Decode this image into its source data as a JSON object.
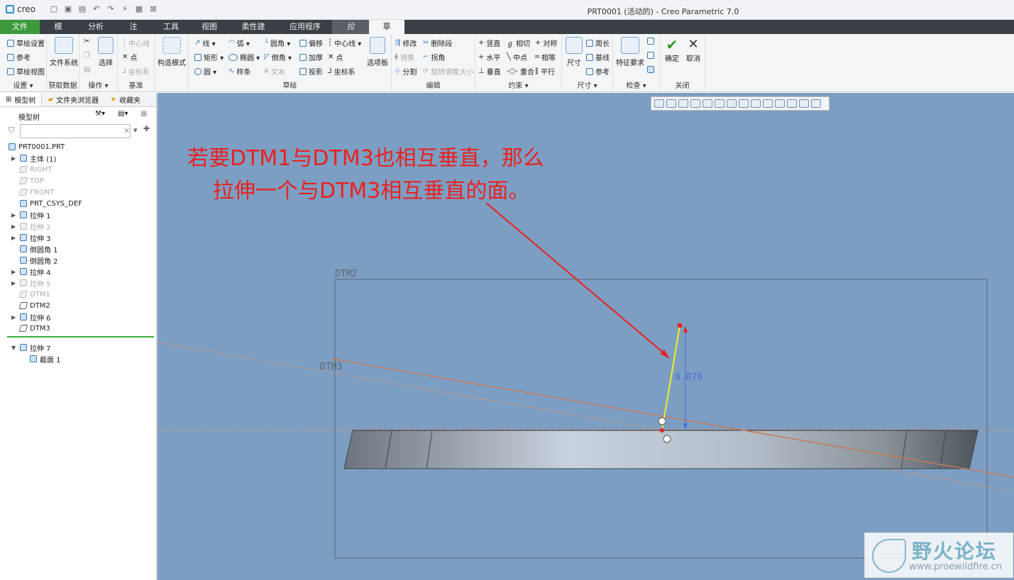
{
  "app": {
    "logo": "creo",
    "window_title": "PRT0001 (活动的) - Creo Parametric 7.0"
  },
  "tabs": [
    "文件",
    "模型",
    "分析",
    "注释",
    "工具",
    "视图",
    "柔性建模",
    "应用程序",
    "拉伸",
    "草绘"
  ],
  "ribbon": {
    "setup": {
      "items": [
        "草绘设置",
        "参考",
        "草绘视图"
      ],
      "label": "设置 ▾"
    },
    "data": {
      "big": "文件系统",
      "label": "获取数据"
    },
    "ops": {
      "big": "选择",
      "label": "操作 ▾"
    },
    "datum": {
      "items": [
        "中心线",
        "点",
        "坐标系"
      ],
      "label": "基准"
    },
    "construct": {
      "big": "构造模式"
    },
    "sketch": {
      "col1": [
        "线 ▾",
        "矩形 ▾",
        "圆 ▾"
      ],
      "col2": [
        "弧 ▾",
        "椭圆 ▾",
        "样条"
      ],
      "col3": [
        "圆角 ▾",
        "倒角 ▾",
        "文本"
      ],
      "col4": [
        "偏移",
        "加厚",
        "投影"
      ],
      "col5": [
        "中心线 ▾",
        "点",
        "坐标系"
      ],
      "big": "选项板",
      "label": "草绘"
    },
    "edit": {
      "col1": [
        "修改",
        "镜像",
        "分割"
      ],
      "col2": [
        "删除段",
        "拐角",
        "旋转调整大小"
      ],
      "label": "编辑"
    },
    "constrain": {
      "col1": [
        "竖直",
        "水平",
        "垂直"
      ],
      "col2": [
        "相切",
        "中点",
        "重合"
      ],
      "col3": [
        "对称",
        "相等",
        "平行"
      ],
      "label": "约束 ▾"
    },
    "dimension": {
      "big": "尺寸",
      "col": [
        "周长",
        "基线",
        "参考"
      ],
      "label": "尺寸 ▾"
    },
    "inspect": {
      "big": "特征要求",
      "label": "检查 ▾"
    },
    "close": {
      "ok": "确定",
      "cancel": "取消",
      "label": "关闭"
    }
  },
  "panel": {
    "tabs": [
      "模型树",
      "文件夹浏览器",
      "收藏夹"
    ],
    "tree_header": "模型树",
    "tree": [
      {
        "label": "PRT0001.PRT",
        "dim": false,
        "arrow": ""
      },
      {
        "label": "主体 (1)",
        "dim": false,
        "arrow": "▶"
      },
      {
        "label": "RIGHT",
        "dim": true,
        "arrow": ""
      },
      {
        "label": "TOP",
        "dim": true,
        "arrow": ""
      },
      {
        "label": "FRONT",
        "dim": true,
        "arrow": ""
      },
      {
        "label": "PRT_CSYS_DEF",
        "dim": false,
        "arrow": ""
      },
      {
        "label": "拉伸 1",
        "dim": false,
        "arrow": "▶"
      },
      {
        "label": "拉伸 2",
        "dim": true,
        "arrow": "▶"
      },
      {
        "label": "拉伸 3",
        "dim": false,
        "arrow": "▶"
      },
      {
        "label": "倒圆角 1",
        "dim": false,
        "arrow": ""
      },
      {
        "label": "倒圆角 2",
        "dim": false,
        "arrow": ""
      },
      {
        "label": "拉伸 4",
        "dim": false,
        "arrow": "▶"
      },
      {
        "label": "拉伸 5",
        "dim": true,
        "arrow": "▶"
      },
      {
        "label": "DTM1",
        "dim": true,
        "arrow": ""
      },
      {
        "label": "DTM2",
        "dim": false,
        "arrow": ""
      },
      {
        "label": "拉伸 6",
        "dim": false,
        "arrow": "▶"
      },
      {
        "label": "DTM3",
        "dim": false,
        "arrow": ""
      }
    ],
    "active": [
      {
        "label": "拉伸 7",
        "arrow": "▼"
      },
      {
        "label": "截面 1",
        "arrow": ""
      }
    ]
  },
  "viewport": {
    "annotation_line1": "若要DTM1与DTM3也相互垂直，那么",
    "annotation_line2": "拉伸一个与DTM3相互垂直的面。",
    "dtm2": "DTM2",
    "dtm3": "DTM3",
    "dimension": "8.076",
    "watermark_cn": "野火论坛",
    "watermark_en": "www.proewildfire.cn"
  },
  "colors": {
    "file_tab": "#3c9a3c",
    "viewport_bg": "#7d9ec3",
    "annotation": "#e8221f",
    "sketch_line": "#f0f020"
  }
}
